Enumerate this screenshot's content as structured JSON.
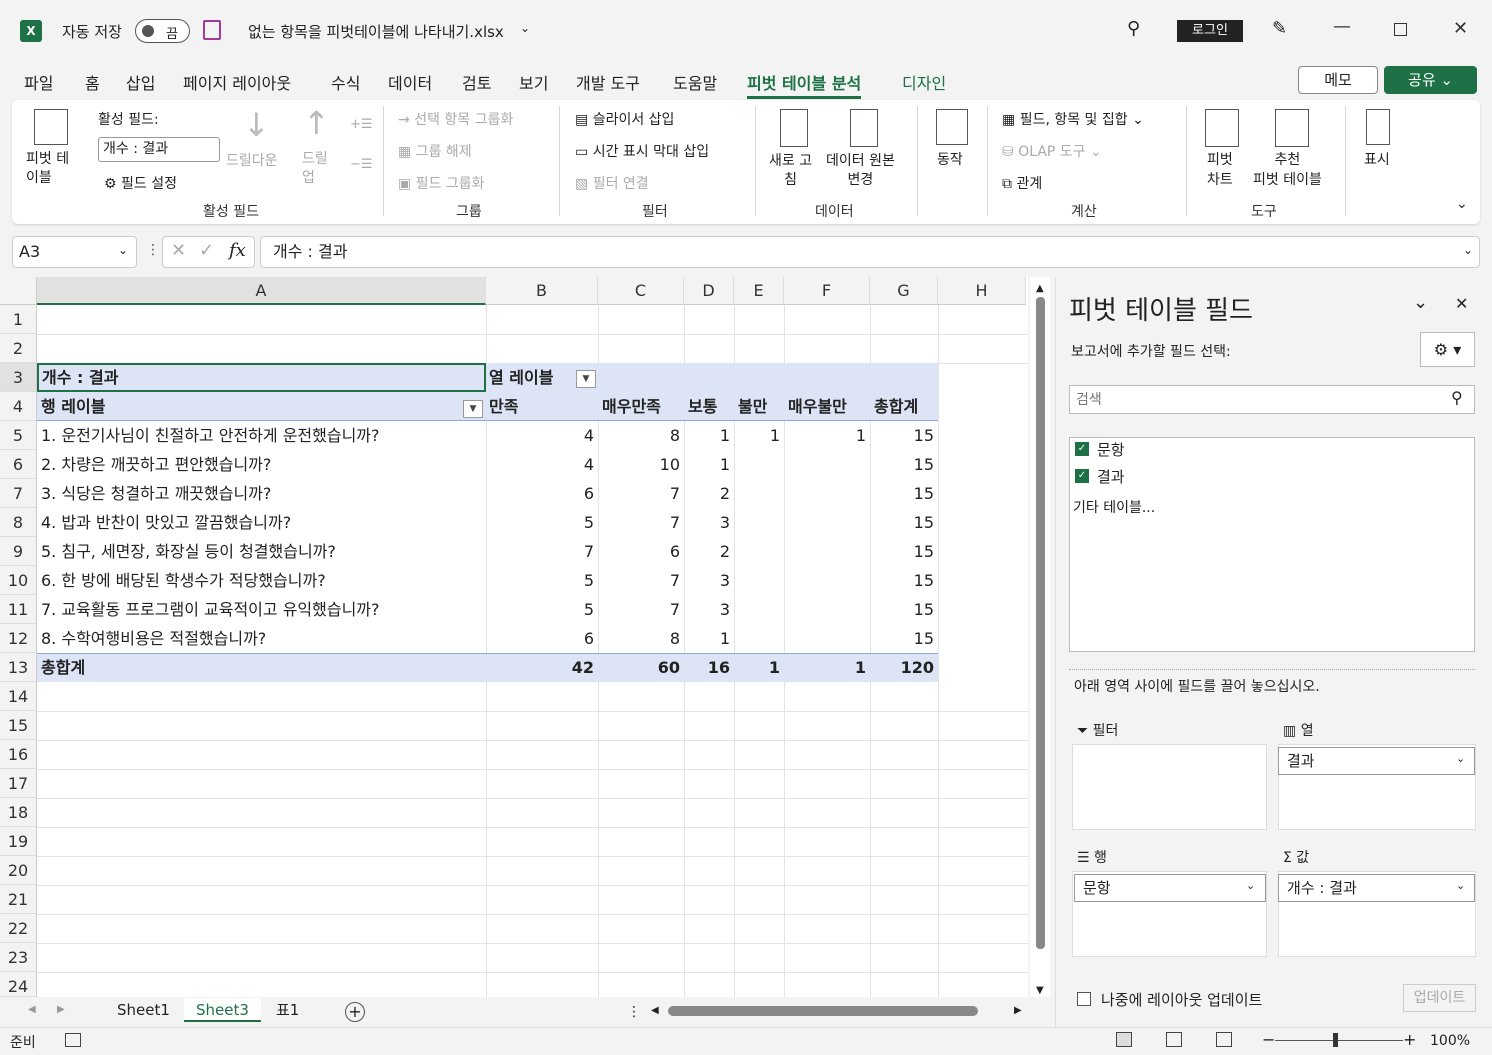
{
  "title": {
    "autosave": "자동 저장",
    "toggle": "끔",
    "filename": "없는 항목을 피벗테이블에 나타내기.xlsx",
    "login": "로그인"
  },
  "menu": [
    "파일",
    "홈",
    "삽입",
    "페이지 레이아웃",
    "수식",
    "데이터",
    "검토",
    "보기",
    "개발 도구",
    "도움말",
    "피벗 테이블 분석",
    "디자인"
  ],
  "memo": "메모",
  "share": "공유",
  "ribbon": {
    "pivot_table": "피벗 테\n이블",
    "active_field_label": "활성 필드:",
    "active_field_value": "개수 : 결과",
    "field_settings": "필드 설정",
    "drill_down": "드릴다운",
    "drill_up": "드릴\n업",
    "group_active": "활성 필드",
    "group_selection": "선택 항목 그룹화",
    "ungroup": "그룹 해제",
    "group_field": "필드 그룹화",
    "group_group": "그룹",
    "insert_slicer": "슬라이서 삽입",
    "insert_timeline": "시간 표시 막대 삽입",
    "filter_connections": "필터 연결",
    "group_filter": "필터",
    "refresh": "새로 고\n침",
    "change_source": "데이터 원본\n변경",
    "group_data": "데이터",
    "actions": "동작",
    "fields_items_sets": "필드, 항목 및 집합",
    "olap_tools": "OLAP 도구",
    "relationships": "관계",
    "group_calc": "계산",
    "pivot_chart": "피벗\n차트",
    "recommended": "추천\n피벗 테이블",
    "group_tools": "도구",
    "show": "표시"
  },
  "formula": {
    "namebox": "A3",
    "content": "개수 : 결과"
  },
  "columns": [
    "A",
    "B",
    "C",
    "D",
    "E",
    "F",
    "G",
    "H"
  ],
  "rows": [
    "1",
    "2",
    "3",
    "4",
    "5",
    "6",
    "7",
    "8",
    "9",
    "10",
    "11",
    "12",
    "13",
    "14",
    "15",
    "16",
    "17",
    "18",
    "19",
    "20",
    "21",
    "22",
    "23",
    "24"
  ],
  "pivot": {
    "corner": "개수 : 결과",
    "col_labels": "열 레이블",
    "row_labels": "행 레이블",
    "headers": [
      "만족",
      "매우만족",
      "보통",
      "불만",
      "매우불만",
      "총합계"
    ],
    "data": [
      {
        "label": "1. 운전기사님이 친절하고 안전하게 운전했습니까?",
        "v": [
          "4",
          "8",
          "1",
          "1",
          "1",
          "15"
        ]
      },
      {
        "label": "2. 차량은 깨끗하고 편안했습니까?",
        "v": [
          "4",
          "10",
          "1",
          "",
          "",
          "15"
        ]
      },
      {
        "label": "3. 식당은 청결하고 깨끗했습니까?",
        "v": [
          "6",
          "7",
          "2",
          "",
          "",
          "15"
        ]
      },
      {
        "label": "4. 밥과 반찬이 맛있고 깔끔했습니까?",
        "v": [
          "5",
          "7",
          "3",
          "",
          "",
          "15"
        ]
      },
      {
        "label": "5. 침구, 세면장, 화장실 등이 청결했습니까?",
        "v": [
          "7",
          "6",
          "2",
          "",
          "",
          "15"
        ]
      },
      {
        "label": "6. 한 방에 배당된 학생수가 적당했습니까?",
        "v": [
          "5",
          "7",
          "3",
          "",
          "",
          "15"
        ]
      },
      {
        "label": "7. 교육활동 프로그램이 교육적이고 유익했습니까?",
        "v": [
          "5",
          "7",
          "3",
          "",
          "",
          "15"
        ]
      },
      {
        "label": "8. 수학여행비용은 적절했습니까?",
        "v": [
          "6",
          "8",
          "1",
          "",
          "",
          "15"
        ]
      }
    ],
    "total_label": "총합계",
    "totals": [
      "42",
      "60",
      "16",
      "1",
      "1",
      "120"
    ]
  },
  "sheets": [
    "Sheet1",
    "Sheet3",
    "표1"
  ],
  "status": {
    "ready": "준비",
    "zoom": "100%"
  },
  "panel": {
    "title": "피벗 테이블 필드",
    "subtitle": "보고서에 추가할 필드 선택:",
    "search_placeholder": "검색",
    "fields": [
      "문항",
      "결과"
    ],
    "more_tables": "기타 테이블...",
    "drag_hint": "아래 영역 사이에 필드를 끌어 놓으십시오.",
    "filter": "필터",
    "columns": "열",
    "rows": "행",
    "values": "값",
    "col_field": "결과",
    "row_field": "문항",
    "value_field": "개수 : 결과",
    "defer": "나중에 레이아웃 업데이트",
    "update": "업데이트"
  }
}
